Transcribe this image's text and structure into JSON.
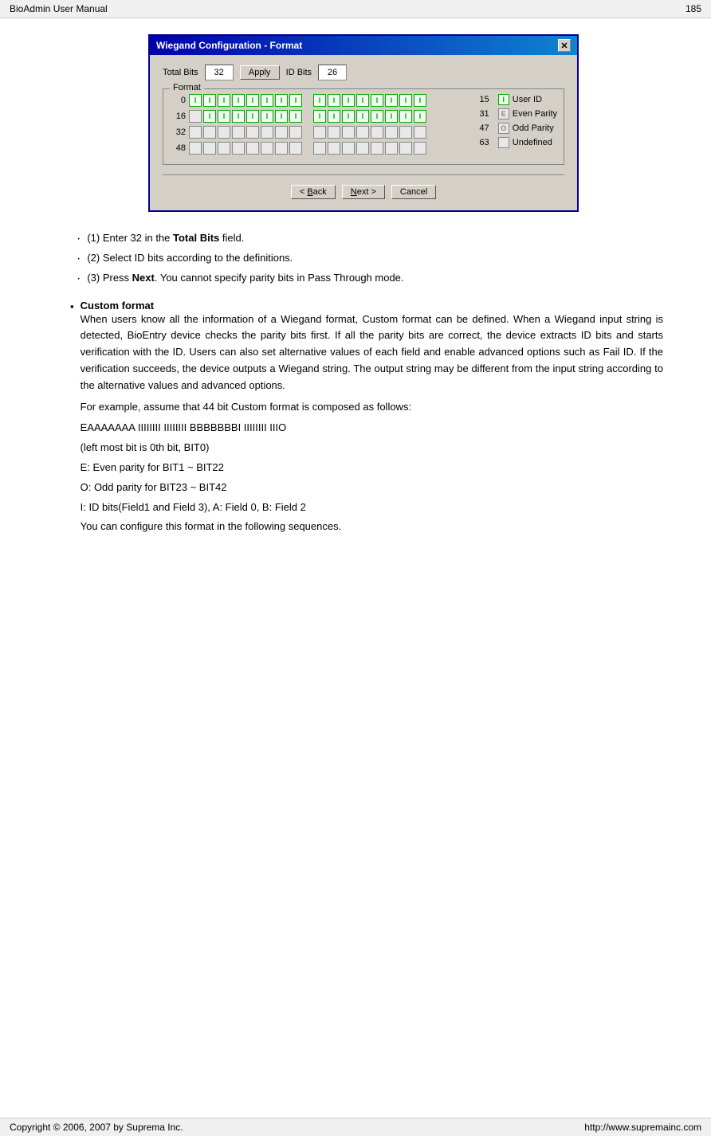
{
  "header": {
    "left": "BioAdmin  User  Manual",
    "right": "185"
  },
  "footer": {
    "left": "Copyright © 2006, 2007 by Suprema Inc.",
    "right": "http://www.supremainc.com"
  },
  "dialog": {
    "title": "Wiegand Configuration - Format",
    "close_label": "✕",
    "total_bits_label": "Total Bits",
    "total_bits_value": "32",
    "apply_label": "Apply",
    "id_bits_label": "ID Bits",
    "id_bits_value": "26",
    "format_label": "Format",
    "row0_label": "0",
    "row16_label": "16",
    "row32_label": "32",
    "row48_label": "48",
    "legend": {
      "label15": "15",
      "label31": "31",
      "label47": "47",
      "label63": "63",
      "user_id_label": "User ID",
      "even_parity_label": "Even Parity",
      "odd_parity_label": "Odd Parity",
      "undefined_label": "Undefined",
      "id_char": "I",
      "even_char": "E",
      "odd_char": "O",
      "undef_char": ""
    },
    "back_label": "< Back",
    "next_label": "Next >",
    "cancel_label": "Cancel"
  },
  "bullets": [
    {
      "dot": "·",
      "text_before": "(1) Enter 32 in the ",
      "bold": "Total Bits",
      "text_after": " field."
    },
    {
      "dot": "·",
      "text_plain": "(2) Select ID bits according to the definitions."
    },
    {
      "dot": "·",
      "text_before": "(3) Press ",
      "bold": "Next",
      "text_after": ". You cannot specify parity bits in Pass Through mode."
    }
  ],
  "section_title": "Custom format",
  "paragraphs": [
    "When users know all the information of a Wiegand format, Custom format can be defined. When a Wiegand input string is detected, BioEntry device checks the parity bits first. If all the parity bits are correct, the device extracts ID bits and starts verification with the ID. Users can also set alternative values of each field and enable advanced options such as Fail ID. If the verification succeeds, the device outputs a Wiegand string. The output string may be different from the input string according to the alternative values and advanced options.",
    "For example, assume that 44 bit Custom format is composed as follows:",
    "EAAAAAAA IIIIIIII IIIIIIII BBBBBBBI IIIIIIII IIIO",
    "(left most bit is 0th bit, BIT0)",
    "E: Even parity for BIT1 ~ BIT22",
    "O: Odd parity for BIT23 ~ BIT42",
    "I: ID bits(Field1 and Field 3), A: Field 0, B: Field 2",
    "You can configure this format in the following sequences."
  ]
}
